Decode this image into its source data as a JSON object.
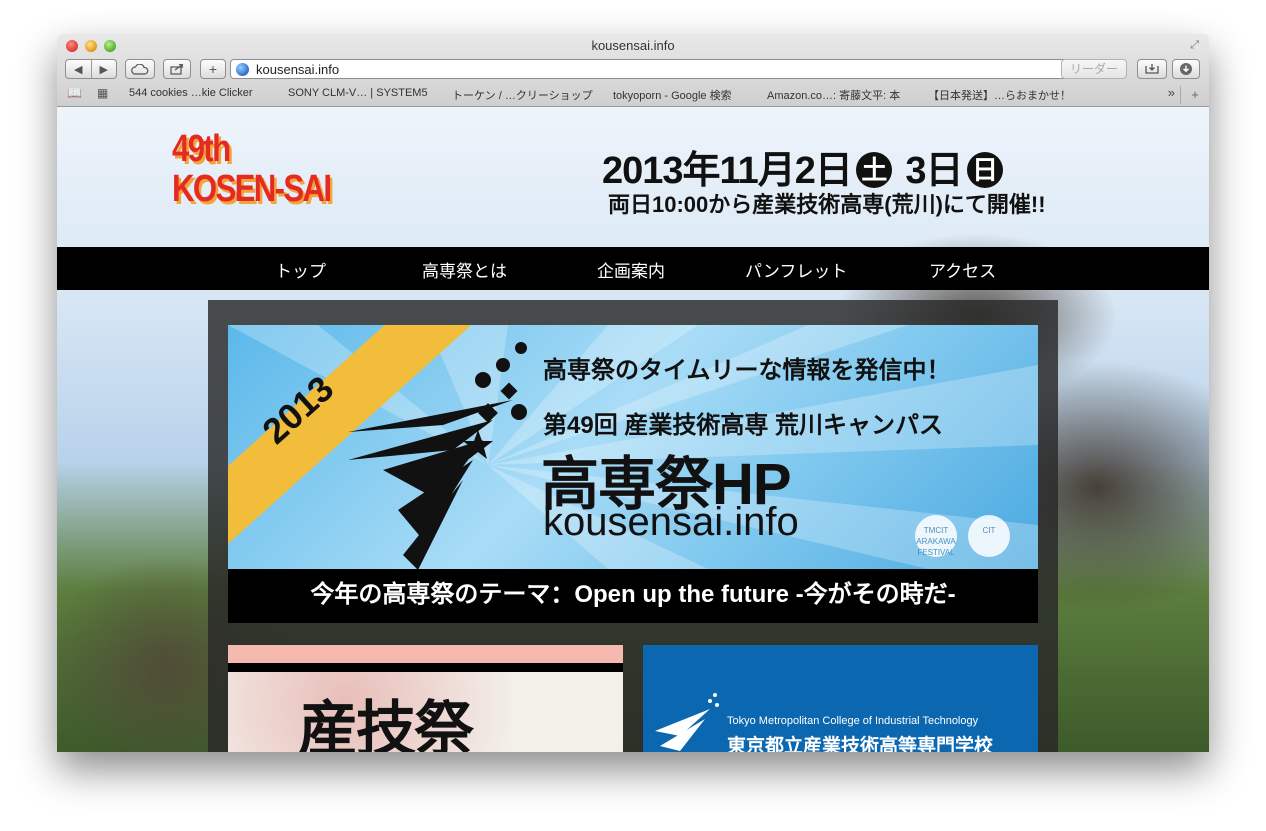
{
  "window": {
    "title": "kousensai.info"
  },
  "toolbar": {
    "back": "◀",
    "forward": "▶",
    "add": "+",
    "url": "kousensai.info",
    "reader_label": "リーダー"
  },
  "bookmarks": [
    "544 cookies …kie Clicker",
    "SONY CLM-V… | SYSTEM5",
    "トーケン / …クリーショップ",
    "tokyoporn - Google 検索",
    "Amazon.co…: 寄藤文平: 本",
    "【日本発送】…らおまかせ！"
  ],
  "header": {
    "logo_line1": "49th",
    "logo_line2": "KOSEN-SAI",
    "date_text1": "2013年11月2日",
    "day1": "土",
    "date_text2": "3日",
    "day2": "日",
    "subtitle": "両日10:00から産業技術高専(荒川)にて開催!!"
  },
  "nav": {
    "items": [
      "トップ",
      "高専祭とは",
      "企画案内",
      "パンフレット",
      "アクセス"
    ]
  },
  "banner": {
    "ribbon_year": "2013",
    "line1": "高専祭のタイムリーな情報を発信中！",
    "line2": "第49回 産業技術高専 荒川キャンパス",
    "line3": "高専祭HP",
    "line4": "kousensai.info",
    "seal1": "TMCIT ARAKAWA FESTIVAL",
    "seal2": "CIT"
  },
  "theme": {
    "text": "今年の高専祭のテーマ：Open up the future -今がその時だ-"
  },
  "cards": {
    "left_title": "産技祭",
    "right_en": "Tokyo Metropolitan College of Industrial Technology",
    "right_jp": "東京都立産業技術高等専門学校"
  },
  "colors": {
    "accent_red": "#e42a21",
    "ribbon_yellow": "#f2bd3b",
    "card_blue": "#0b67b0"
  }
}
